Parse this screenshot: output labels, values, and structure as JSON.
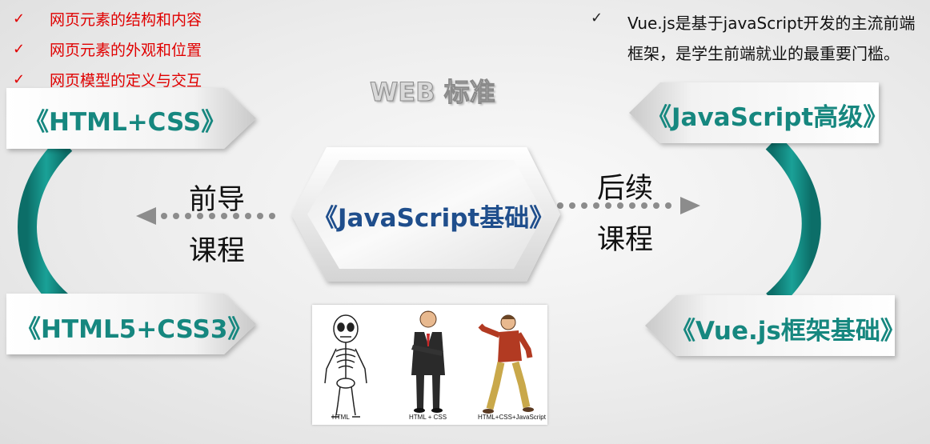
{
  "left_checklist": [
    {
      "icon": "checkmark-icon",
      "text": "网页元素的结构和内容"
    },
    {
      "icon": "checkmark-icon",
      "text": "网页元素的外观和位置"
    },
    {
      "icon": "checkmark-icon",
      "text": "网页模型的定义与交互"
    }
  ],
  "right_checklist": {
    "icon": "checkmark-icon",
    "line1": "Vue.js是基于javaScript开发的主流前端",
    "line2": "框架，是学生前端就业的最重要门槛。"
  },
  "web_title": "WEB 标准",
  "courses": {
    "html_css": "《HTML+CSS》",
    "html5_css3": "《HTML5+CSS3》",
    "js_basic": "《JavaScript基础》",
    "js_advanced": "《JavaScript高级》",
    "vue_basic": "《Vue.js框架基础》"
  },
  "prereq": {
    "line1": "前导",
    "line2": "课程"
  },
  "followup": {
    "line1": "后续",
    "line2": "课程"
  },
  "comic": {
    "captions": [
      "HTML",
      "HTML + CSS",
      "HTML+CSS+JavaScript"
    ],
    "figures": [
      "skeleton-figure",
      "suited-man-figure",
      "dancing-man-figure"
    ]
  },
  "colors": {
    "teal": "#16877f",
    "navy": "#1f4e8c",
    "red": "#e00000",
    "arrow_gray": "#8c8c8c"
  }
}
